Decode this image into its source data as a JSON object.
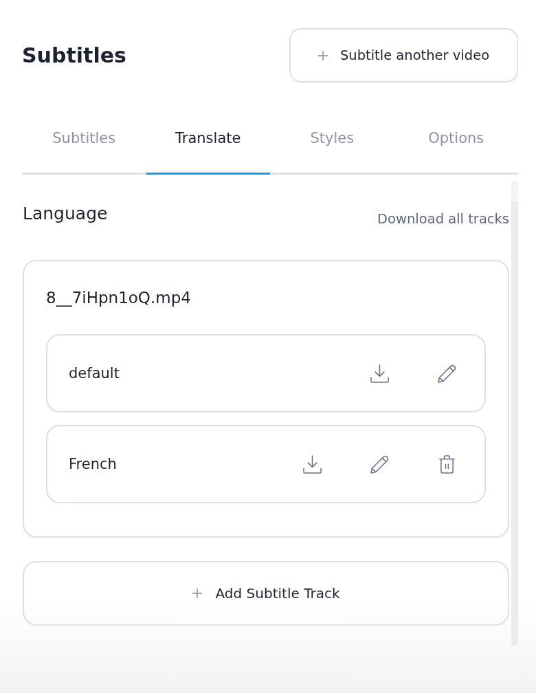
{
  "header": {
    "title": "Subtitles",
    "action_button": {
      "label": "Subtitle another video"
    }
  },
  "tabs": [
    {
      "label": "Subtitles",
      "selected": false
    },
    {
      "label": "Translate",
      "selected": true
    },
    {
      "label": "Styles",
      "selected": false
    },
    {
      "label": "Options",
      "selected": false
    }
  ],
  "section": {
    "title": "Language",
    "link": "Download all tracks"
  },
  "file": {
    "name": "8__7iHpn1oQ.mp4",
    "tracks": [
      {
        "name": "default",
        "deletable": false
      },
      {
        "name": "French",
        "deletable": true
      }
    ]
  },
  "add_button": {
    "label": "Add Subtitle Track"
  }
}
